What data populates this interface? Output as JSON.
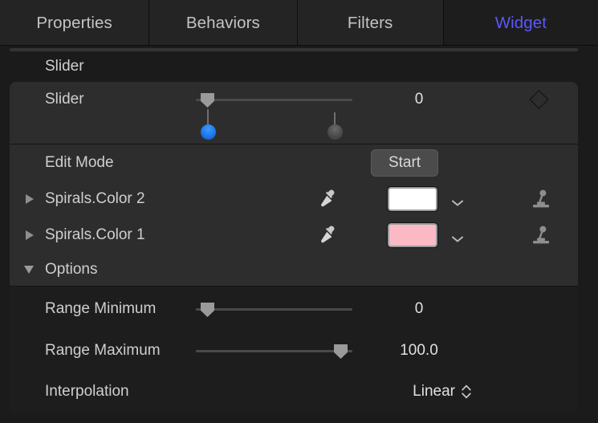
{
  "window": {
    "background": "#1b1b1b",
    "accent": "#5b56ff"
  },
  "tabs": [
    {
      "label": "Properties",
      "active": false
    },
    {
      "label": "Behaviors",
      "active": false
    },
    {
      "label": "Filters",
      "active": false
    },
    {
      "label": "Widget",
      "active": true
    }
  ],
  "groups": [
    {
      "header": "Slider",
      "rows": [
        {
          "label": "Slider",
          "type": "slider-with-handles",
          "value": "0",
          "slider": {
            "percent": 0
          },
          "keyframe_icon": "keyframe-diamond-icon",
          "handles": [
            {
              "name": "blue-handle-dot",
              "color": "#1a74e8",
              "percent": 2
            },
            {
              "name": "grey-handle-dot",
              "color": "#494949",
              "percent": 82
            }
          ]
        }
      ]
    },
    {
      "header": "",
      "rows": [
        {
          "label": "Edit Mode",
          "type": "button",
          "button_label": "Start",
          "button_name": "edit-mode-start-button"
        },
        {
          "label": "Spirals.Color 2",
          "type": "color",
          "disclosure": "collapsed",
          "eyedropper_icon": "eyedropper-icon",
          "swatch": "#ffffff",
          "chevron_icon": "chevron-down-icon",
          "rig_icon": "rig-joystick-icon"
        },
        {
          "label": "Spirals.Color 1",
          "type": "color",
          "disclosure": "collapsed",
          "eyedropper_icon": "eyedropper-icon",
          "swatch": "#fbb9c5",
          "chevron_icon": "chevron-down-icon",
          "rig_icon": "rig-joystick-icon"
        }
      ]
    },
    {
      "header": "Options",
      "disclosure": "expanded",
      "rows": [
        {
          "label": "Range Minimum",
          "type": "slider",
          "value": "0",
          "slider": {
            "percent": 0
          }
        },
        {
          "label": "Range Maximum",
          "type": "slider",
          "value": "100.0",
          "slider": {
            "percent": 100
          }
        },
        {
          "label": "Interpolation",
          "type": "popup",
          "value": "Linear",
          "stepper_icon": "stepper-updown-icon"
        }
      ]
    }
  ]
}
